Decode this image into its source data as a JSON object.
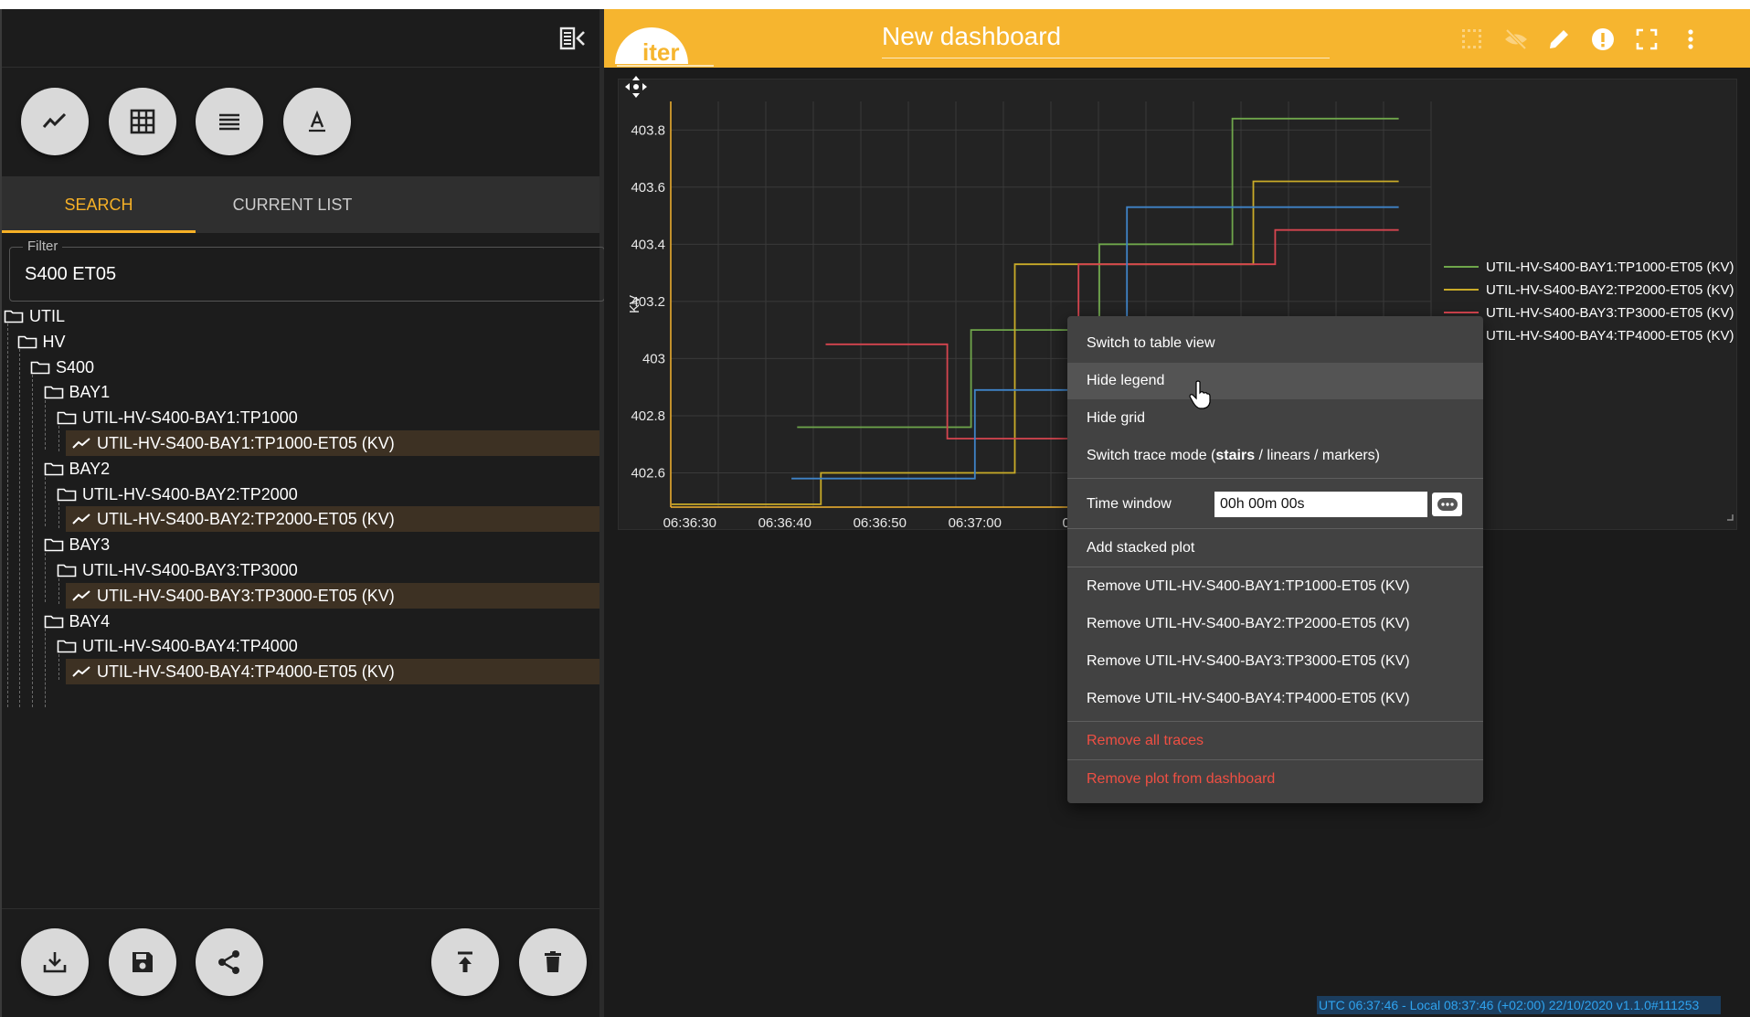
{
  "left_panel": {
    "tools": [
      {
        "name": "plot-tool",
        "icon": "trend-icon"
      },
      {
        "name": "table-tool",
        "icon": "grid-icon"
      },
      {
        "name": "list-tool",
        "icon": "lines-icon"
      },
      {
        "name": "text-tool",
        "icon": "text-a-icon"
      }
    ],
    "tabs": [
      {
        "label": "SEARCH",
        "active": true
      },
      {
        "label": "CURRENT LIST",
        "active": false
      }
    ],
    "filter": {
      "label": "Filter",
      "value": "S400 ET05"
    },
    "tree": [
      {
        "label": "UTIL",
        "type": "folder"
      },
      {
        "label": "HV",
        "type": "folder"
      },
      {
        "label": "S400",
        "type": "folder"
      },
      {
        "label": "BAY1",
        "type": "folder"
      },
      {
        "label": "UTIL-HV-S400-BAY1:TP1000",
        "type": "folder"
      },
      {
        "label": "UTIL-HV-S400-BAY1:TP1000-ET05 (KV)",
        "type": "signal"
      },
      {
        "label": "BAY2",
        "type": "folder"
      },
      {
        "label": "UTIL-HV-S400-BAY2:TP2000",
        "type": "folder"
      },
      {
        "label": "UTIL-HV-S400-BAY2:TP2000-ET05 (KV)",
        "type": "signal"
      },
      {
        "label": "BAY3",
        "type": "folder"
      },
      {
        "label": "UTIL-HV-S400-BAY3:TP3000",
        "type": "folder"
      },
      {
        "label": "UTIL-HV-S400-BAY3:TP3000-ET05 (KV)",
        "type": "signal"
      },
      {
        "label": "BAY4",
        "type": "folder"
      },
      {
        "label": "UTIL-HV-S400-BAY4:TP4000",
        "type": "folder"
      },
      {
        "label": "UTIL-HV-S400-BAY4:TP4000-ET05 (KV)",
        "type": "signal"
      }
    ],
    "bottom_actions": [
      {
        "name": "download-button",
        "icon": "download-icon"
      },
      {
        "name": "save-button",
        "icon": "floppy-icon"
      },
      {
        "name": "share-button",
        "icon": "share-icon"
      },
      {
        "name": "upload-button",
        "icon": "upload-icon"
      },
      {
        "name": "delete-button",
        "icon": "trash-icon"
      }
    ]
  },
  "header": {
    "logo_text": "iter",
    "title": "New dashboard",
    "icons": [
      "grid-dots-icon",
      "eye-off-icon",
      "pencil-icon",
      "alert-icon",
      "fullscreen-icon",
      "more-vert-icon"
    ],
    "accent": "#f6b52f"
  },
  "chart_data": {
    "type": "line",
    "step": true,
    "ylabel": "KV",
    "ylim": [
      402.48,
      403.9
    ],
    "yticks": [
      "403.8",
      "403.6",
      "403.4",
      "403.2",
      "403",
      "402.8",
      "402.6"
    ],
    "xticks": [
      "06:36:30",
      "06:36:40",
      "06:36:50",
      "06:37:00",
      "06"
    ],
    "grid": true,
    "legend_position": "right",
    "series": [
      {
        "name": "UTIL-HV-S400-BAY1:TP1000-ET05 (KV)",
        "color": "#6fa64b",
        "points": [
          [
            13.3,
            402.76
          ],
          [
            31.6,
            402.76
          ],
          [
            31.6,
            403.1
          ],
          [
            45.1,
            403.1
          ],
          [
            45.1,
            403.4
          ],
          [
            59.1,
            403.4
          ],
          [
            59.1,
            403.84
          ],
          [
            76.6,
            403.84
          ]
        ]
      },
      {
        "name": "UTIL-HV-S400-BAY2:TP2000-ET05 (KV)",
        "color": "#c9ab28",
        "points": [
          [
            0.1,
            402.49
          ],
          [
            15.8,
            402.49
          ],
          [
            15.8,
            402.6
          ],
          [
            36.2,
            402.6
          ],
          [
            36.2,
            403.33
          ],
          [
            61.3,
            403.33
          ],
          [
            61.3,
            403.62
          ],
          [
            76.6,
            403.62
          ]
        ]
      },
      {
        "name": "UTIL-HV-S400-BAY3:TP3000-ET05 (KV)",
        "color": "#d6454f",
        "points": [
          [
            16.3,
            403.05
          ],
          [
            29.1,
            403.05
          ],
          [
            29.1,
            402.72
          ],
          [
            42.9,
            402.72
          ],
          [
            42.9,
            403.33
          ],
          [
            63.6,
            403.33
          ],
          [
            63.6,
            403.45
          ],
          [
            76.6,
            403.45
          ]
        ]
      },
      {
        "name": "UTIL-HV-S400-BAY4:TP4000-ET05 (KV)",
        "color": "#3f83c7",
        "points": [
          [
            12.7,
            402.58
          ],
          [
            32.0,
            402.58
          ],
          [
            32.0,
            402.89
          ],
          [
            48.0,
            402.89
          ],
          [
            48.0,
            403.53
          ],
          [
            76.6,
            403.53
          ]
        ]
      }
    ]
  },
  "context_menu": {
    "switch_table": "Switch to table view",
    "hide_legend": "Hide legend",
    "hide_grid": "Hide grid",
    "trace_mode_prefix": "Switch trace mode (",
    "trace_mode_bold": "stairs",
    "trace_mode_suffix": " / linears / markers)",
    "time_window_label": "Time window",
    "time_window_value": "00h 00m 00s",
    "add_stacked": "Add stacked plot",
    "remove_items": [
      "Remove UTIL-HV-S400-BAY1:TP1000-ET05 (KV)",
      "Remove UTIL-HV-S400-BAY2:TP2000-ET05 (KV)",
      "Remove UTIL-HV-S400-BAY3:TP3000-ET05 (KV)",
      "Remove UTIL-HV-S400-BAY4:TP4000-ET05 (KV)"
    ],
    "remove_all": "Remove all traces",
    "remove_plot": "Remove plot from dashboard",
    "danger_color": "#ef4f43"
  },
  "status_bar": {
    "text": "UTC 06:37:46 - Local 08:37:46 (+02:00) 22/10/2020 v1.1.0#111253"
  }
}
